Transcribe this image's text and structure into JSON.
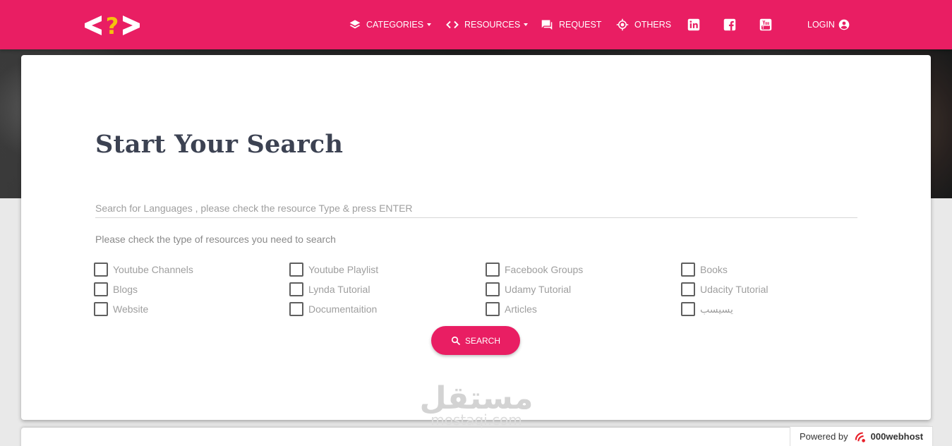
{
  "nav": {
    "logo_mark": "<?>",
    "items": [
      {
        "label": "CATEGORIES",
        "icon": "layers-icon",
        "dropdown": true
      },
      {
        "label": "RESOURCES",
        "icon": "code-icon",
        "dropdown": true
      },
      {
        "label": "REQUEST",
        "icon": "chat-icon",
        "dropdown": false
      },
      {
        "label": "OTHERS",
        "icon": "target-icon",
        "dropdown": false
      }
    ],
    "social": [
      "linkedin-icon",
      "facebook-icon",
      "youtube-icon"
    ],
    "login_label": "LOGIN",
    "colors": {
      "primary": "#e91e63",
      "text": "#ffffff"
    }
  },
  "main": {
    "title": "Start Your Search",
    "search_placeholder": "Search for Languages , please check the resource Type & press ENTER",
    "search_value": "",
    "hint": "Please check the type of resources you need to search",
    "resource_types": [
      {
        "label": "Youtube Channels",
        "checked": false
      },
      {
        "label": "Youtube Playlist",
        "checked": false
      },
      {
        "label": "Facebook Groups",
        "checked": false
      },
      {
        "label": "Books",
        "checked": false
      },
      {
        "label": "Blogs",
        "checked": false
      },
      {
        "label": "Lynda Tutorial",
        "checked": false
      },
      {
        "label": "Udamy Tutorial",
        "checked": false
      },
      {
        "label": "Udacity Tutorial",
        "checked": false
      },
      {
        "label": "Website",
        "checked": false
      },
      {
        "label": "Documentaition",
        "checked": false
      },
      {
        "label": "Articles",
        "checked": false
      },
      {
        "label": "يسيسب",
        "checked": false
      }
    ],
    "search_button": "SEARCH"
  },
  "watermark": {
    "arabic": "مستقل",
    "latin": "mostaqi.com"
  },
  "footer_badge": {
    "prefix": "Powered by",
    "brand": "000webhost"
  }
}
